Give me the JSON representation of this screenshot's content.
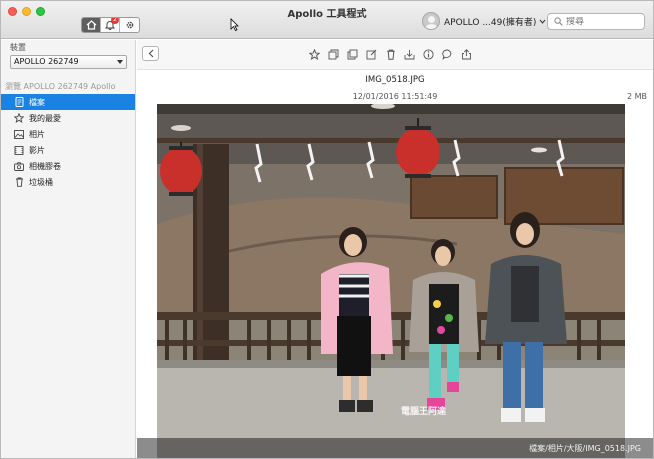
{
  "window": {
    "title": "Apollo 工具程式"
  },
  "header": {
    "notification_count": "2",
    "user_label": "APOLLO ...49(擁有者)",
    "search_placeholder": "搜尋"
  },
  "sidebar": {
    "device_label": "裝置",
    "device_value": "APOLLO 262749",
    "browse_label": "瀏覽 APOLLO 262749 Apollo",
    "items": [
      {
        "label": "檔案",
        "icon": "file-icon",
        "active": true
      },
      {
        "label": "我的最愛",
        "icon": "star-icon",
        "active": false
      },
      {
        "label": "相片",
        "icon": "photo-icon",
        "active": false
      },
      {
        "label": "影片",
        "icon": "film-icon",
        "active": false
      },
      {
        "label": "相機膠卷",
        "icon": "camera-icon",
        "active": false
      },
      {
        "label": "垃圾桶",
        "icon": "trash-icon",
        "active": false
      }
    ]
  },
  "viewer": {
    "file_name": "IMG_0518.JPG",
    "date": "12/01/2016 11:51:49",
    "size": "2 MB",
    "path_caption": "檔案/相片/大阪/IMG_0518.JPG",
    "watermark": "電腦王阿達"
  },
  "toolbar": {
    "tools": [
      "star-icon",
      "copy-to-icon",
      "duplicate-icon",
      "edit-icon",
      "delete-icon",
      "download-icon",
      "info-icon",
      "comment-icon",
      "share-icon"
    ]
  }
}
